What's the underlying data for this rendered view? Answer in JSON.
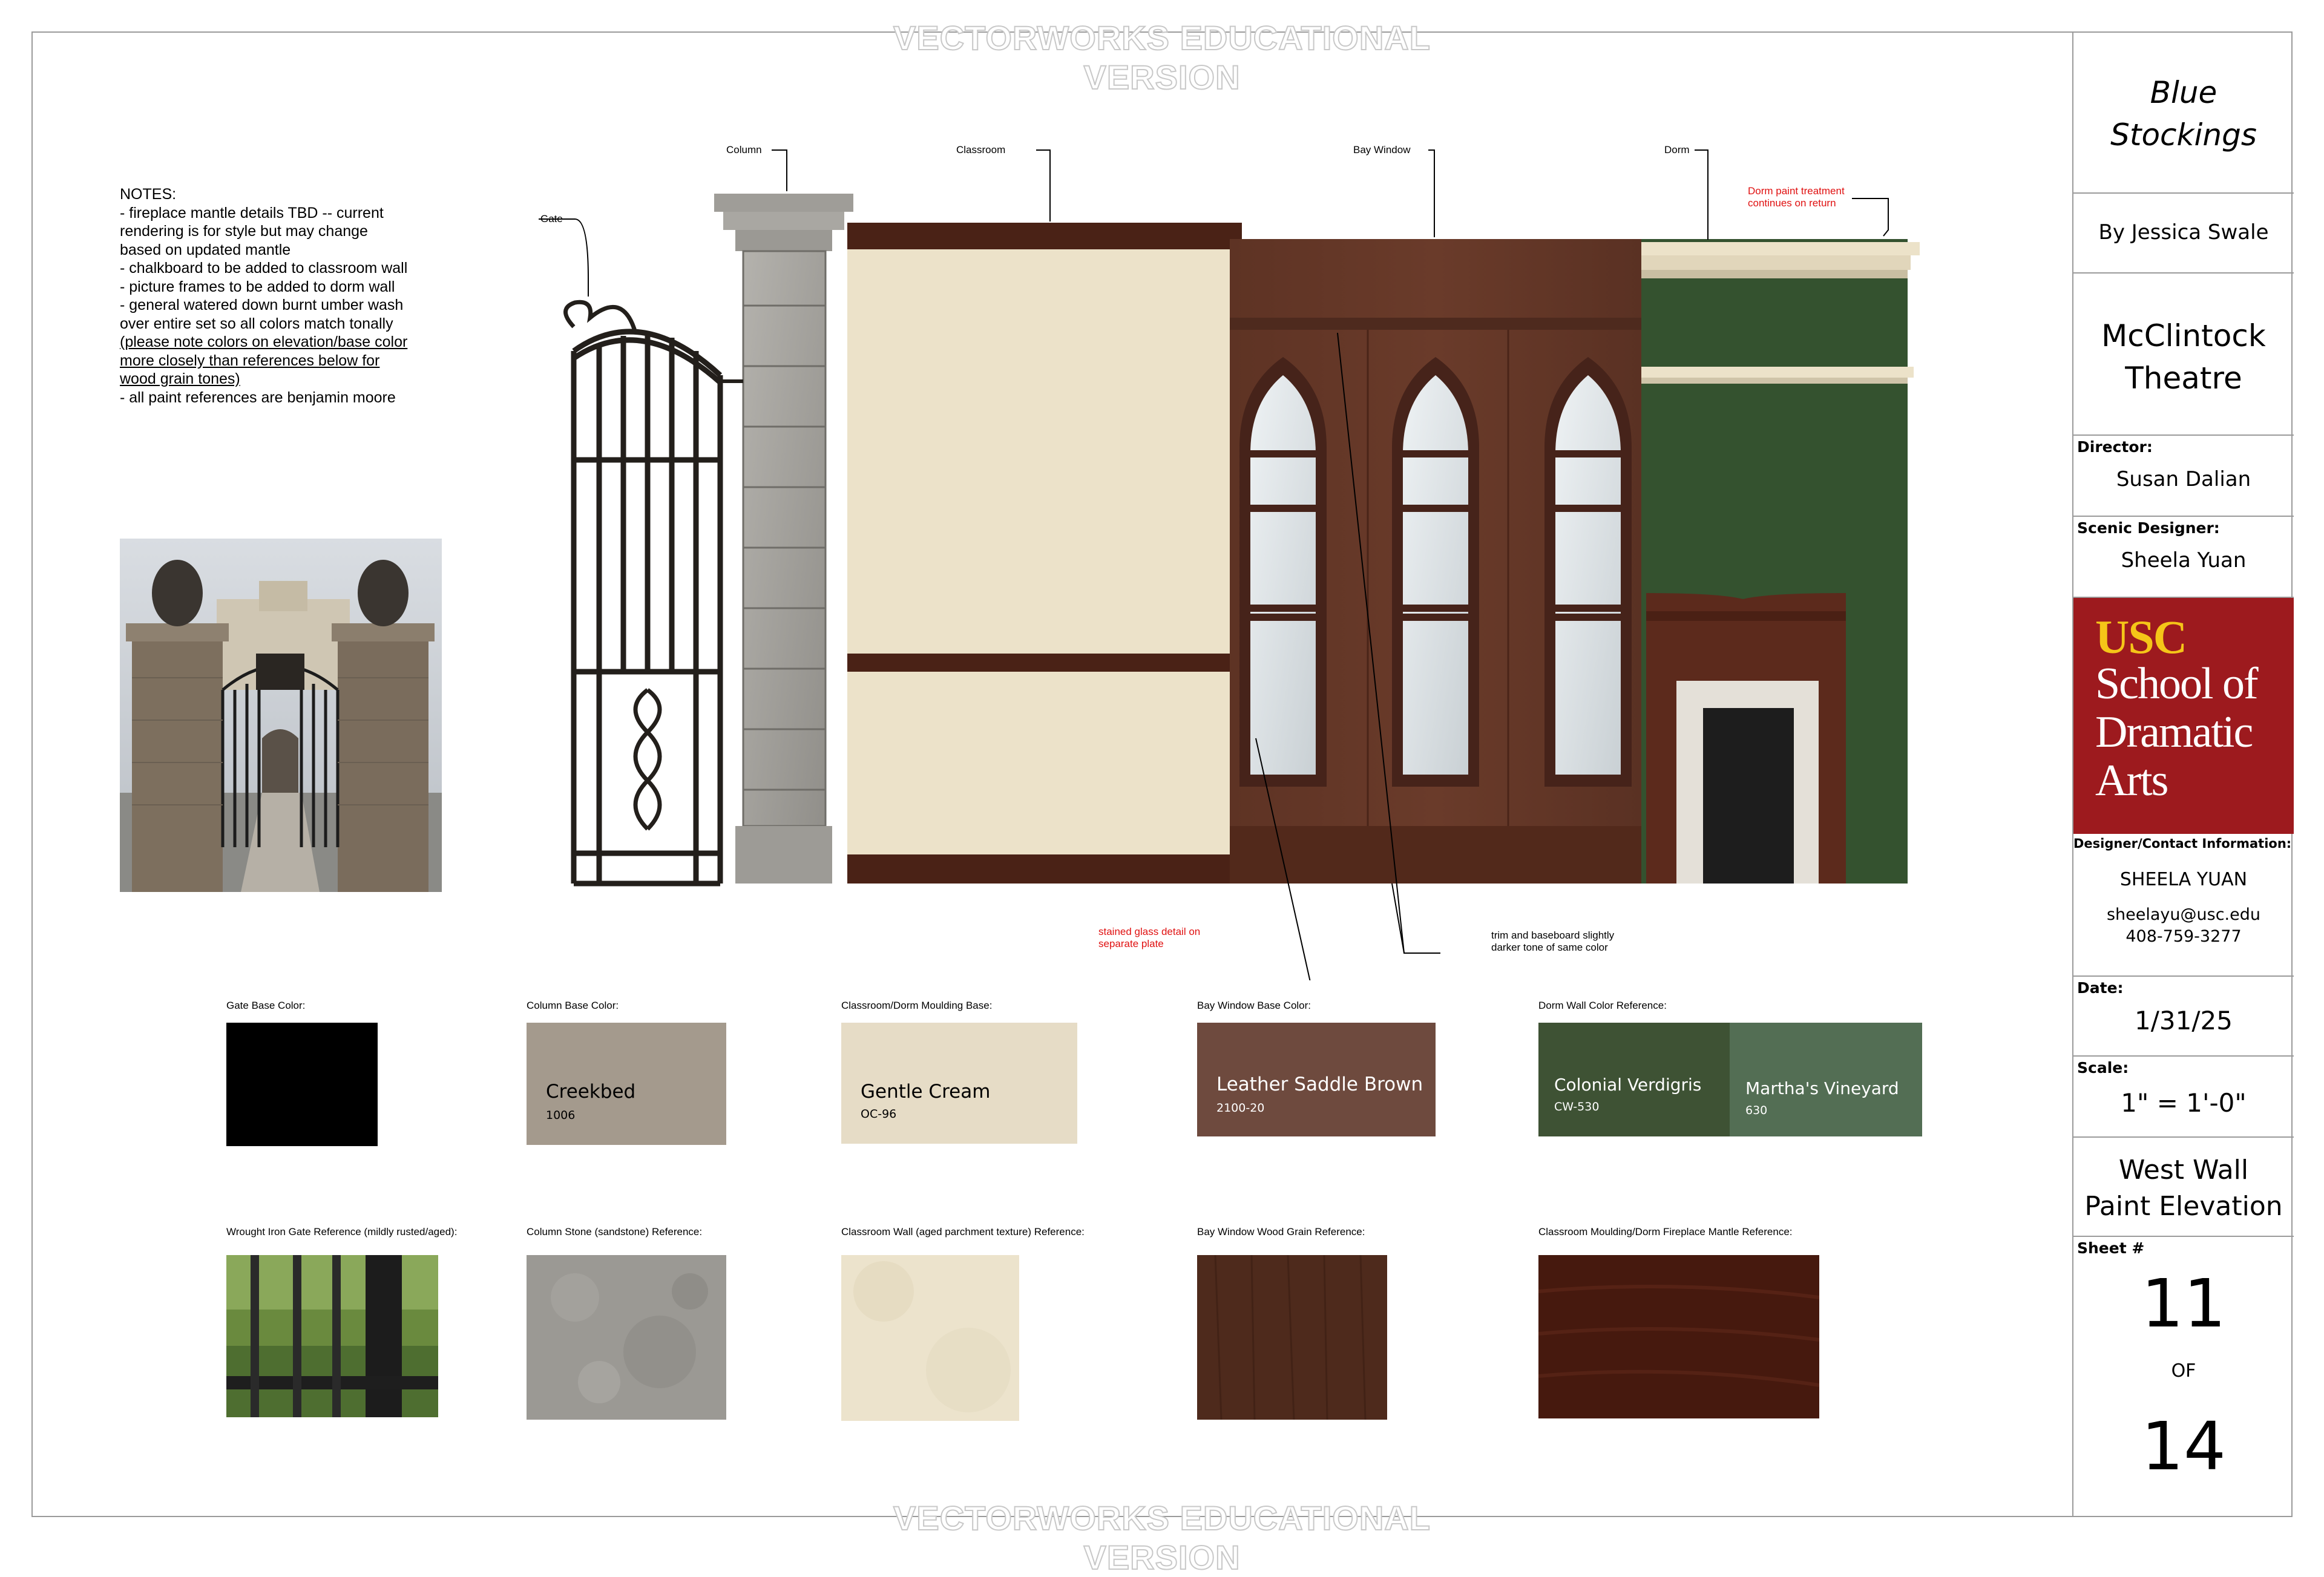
{
  "watermark": "VECTORWORKS EDUCATIONAL VERSION",
  "notes": "NOTES:\n- fireplace mantle details TBD -- current rendering is for style but may change based on updated mantle\n- chalkboard to be added to classroom wall\n- picture frames to be added to dorm wall\n- general watered down burnt umber wash over entire set so all colors match tonally (please note colors on elevation/base color more closely than references below for wood grain tones)\n- all paint references are benjamin moore",
  "notes_parts": {
    "main": "NOTES:\n- fireplace mantle details TBD -- current rendering is for style but may change based on updated mantle\n- chalkboard to be added to classroom wall\n- picture frames to be added to dorm wall\n- general watered down burnt umber wash over entire set so all colors match tonally ",
    "underlined": "(please note colors on elevation/base color more closely than references below for wood grain tones)",
    "tail": "\n- all paint references are benjamin moore"
  },
  "elevation_labels": {
    "gate": "Gate",
    "column": "Column",
    "classroom": "Classroom",
    "bay_window": "Bay Window",
    "dorm": "Dorm",
    "dorm_note": "Dorm paint treatment continues on return",
    "stained_glass_note": "stained glass detail on separate plate",
    "trim_note": "trim and baseboard slightly darker tone of same color"
  },
  "swatches": [
    {
      "label": "Gate Base Color:",
      "name": "",
      "code": "",
      "color": "#000000"
    },
    {
      "label": "Column Base Color:",
      "name": "Creekbed",
      "code": "1006",
      "color": "#a49a8d"
    },
    {
      "label": "Classroom/Dorm Moulding Base:",
      "name": "Gentle Cream",
      "code": "OC-96",
      "color": "#e6dcc6"
    },
    {
      "label": "Bay Window Base Color:",
      "name": "Leather Saddle Brown",
      "code": "2100-20",
      "color": "#6e4a3e"
    },
    {
      "label": "Dorm Wall Color Reference:",
      "name": "Colonial Verdigris",
      "code": "CW-530",
      "color": "#3e5234",
      "name2": "Martha's Vineyard",
      "code2": "630",
      "color2": "#536e54"
    }
  ],
  "references": [
    {
      "label": "Wrought Iron Gate Reference (mildly rusted/aged):"
    },
    {
      "label": "Column Stone (sandstone) Reference:"
    },
    {
      "label": "Classroom Wall (aged parchment texture) Reference:"
    },
    {
      "label": "Bay Window Wood Grain Reference:"
    },
    {
      "label": "Classroom Moulding/Dorm Fireplace Mantle Reference:"
    }
  ],
  "title_block": {
    "title": "Blue Stockings",
    "title_line1": "Blue",
    "title_line2": "Stockings",
    "author": "By Jessica Swale",
    "theatre_line1": "McClintock",
    "theatre_line2": "Theatre",
    "director_label": "Director:",
    "director": "Susan Dalian",
    "designer_label": "Scenic Designer:",
    "designer": "Sheela Yuan",
    "logo_line1": "USC",
    "logo_line2": "School of",
    "logo_line3": "Dramatic",
    "logo_line4": "Arts",
    "contact_label": "Designer/Contact Information:",
    "contact_name": "SHEELA YUAN",
    "contact_email": "sheelayu@usc.edu",
    "contact_phone": "408-759-3277",
    "date_label": "Date:",
    "date": "1/31/25",
    "scale_label": "Scale:",
    "scale": "1\" = 1'-0\"",
    "sheet_title_line1": "West Wall",
    "sheet_title_line2": "Paint Elevation",
    "sheet_label": "Sheet #",
    "sheet_num": "11",
    "sheet_of": "OF",
    "sheet_total": "14"
  }
}
